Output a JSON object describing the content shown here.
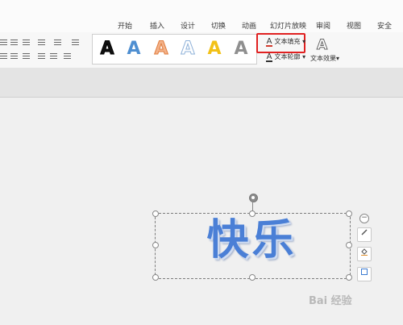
{
  "tabs": [
    "开始",
    "插入",
    "设计",
    "切换",
    "动画",
    "幻灯片放映",
    "审阅",
    "视图",
    "安全"
  ],
  "ribbon": {
    "text_fill_label": "文本填充",
    "text_outline_label": "文本轮廓",
    "text_effect_label": "文本效果",
    "dropdown_glyph": "▾"
  },
  "wordart_gallery": [
    "A",
    "A",
    "A",
    "A",
    "A",
    "A"
  ],
  "textbox": {
    "text": "快乐"
  },
  "watermark": "Bai 经验"
}
